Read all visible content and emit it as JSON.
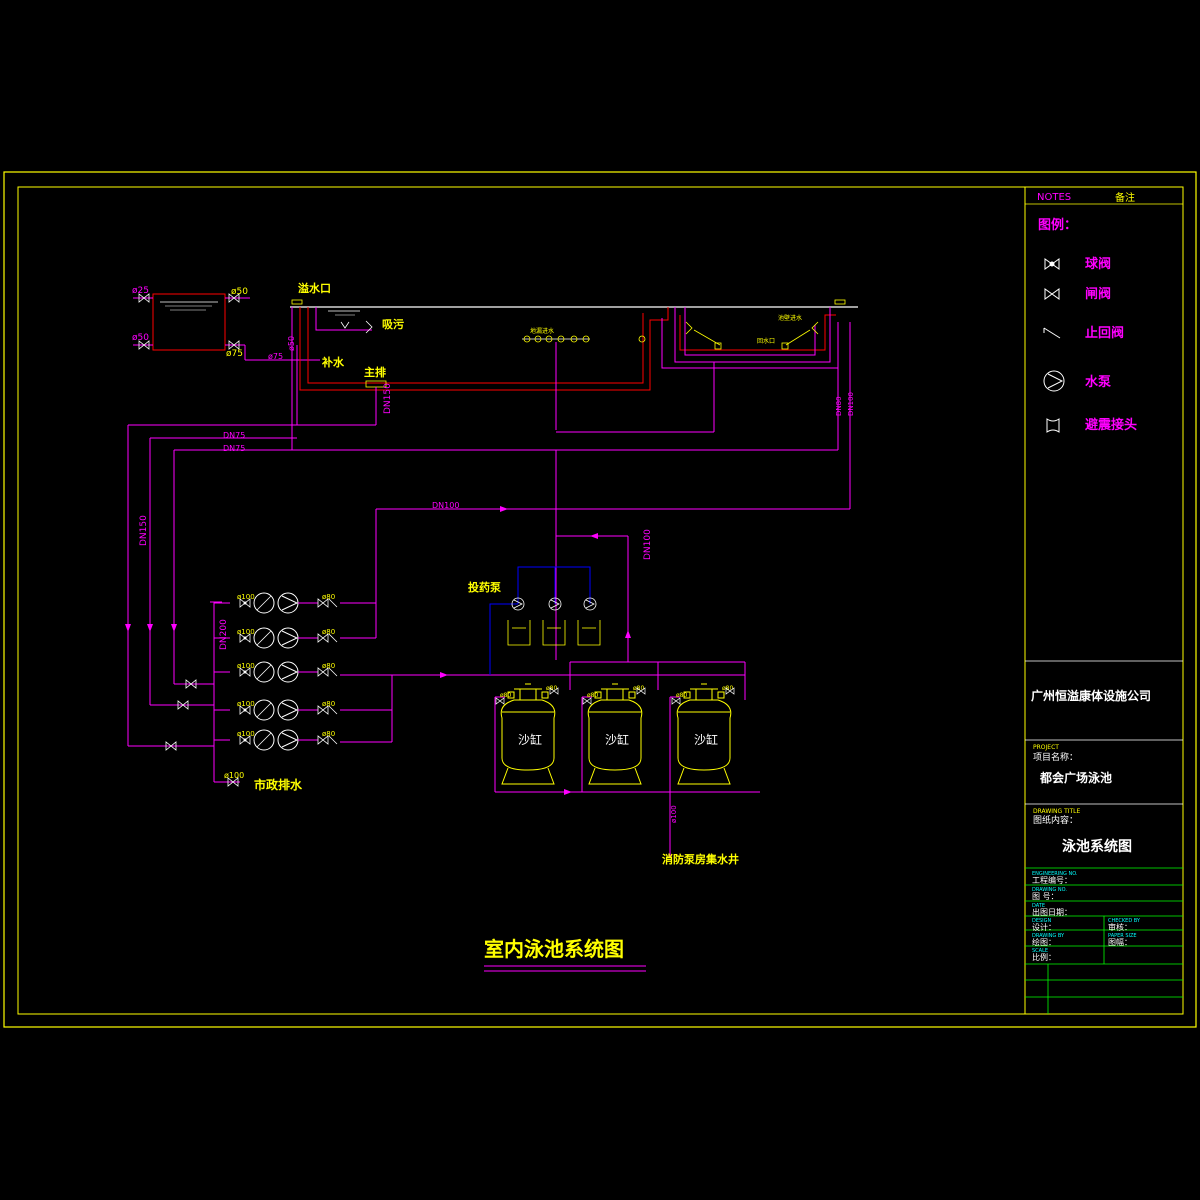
{
  "drawing": {
    "main_title": "室内泳池系统图"
  },
  "legend": {
    "notes_label": "NOTES",
    "notes_cn": "备注",
    "legend_title": "图例：",
    "items": [
      {
        "icon": "ball-valve-icon",
        "label": "球阀"
      },
      {
        "icon": "gate-valve-icon",
        "label": "闸阀"
      },
      {
        "icon": "check-valve-icon",
        "label": "止回阀"
      },
      {
        "icon": "pump-icon",
        "label": "水泵"
      },
      {
        "icon": "shock-absorber-joint-icon",
        "label": "避震接头"
      }
    ]
  },
  "title_block": {
    "company": "广州恒溢康体设施公司",
    "project_en": "PROJECT",
    "project_label": "项目名称：",
    "project_name": "都会广场泳池",
    "drawing_title_en": "DRAWING TITLE",
    "drawing_content_label": "图纸内容：",
    "drawing_name": "泳池系统图",
    "engineering_no_en": "ENGINEERING NO.",
    "engineering_no": "工程编号：",
    "drawing_no_en": "DRAWING NO.",
    "drawing_no": "图  号：",
    "date_en": "DATE",
    "date": "出图日期：",
    "design_en": "DESIGN",
    "design": "设计：",
    "checked_en": "CHECKED BY",
    "checked": "审核：",
    "drawn_en": "DRAWING BY",
    "drawn": "绘图：",
    "paper_en": "PAPER SIZE",
    "paper": "图幅：",
    "scale_en": "SCALE",
    "scale": "比例："
  },
  "labels": {
    "phi25": "ø25",
    "phi50_a": "ø50",
    "phi50_b": "ø50",
    "phi75_a": "ø75",
    "phi75_b": "ø75",
    "phi50_c": "ø50",
    "overflow": "溢水口",
    "suction": "吸污",
    "makeup": "补水",
    "main_drain": "主排",
    "dn150_v": "DN150",
    "dn75_a": "DN75",
    "dn75_b": "DN75",
    "dn150_left": "DN150",
    "dn100_h": "DN100",
    "dn100_v": "DN100",
    "dn80_v": "DN80",
    "dn100_v2": "DN100",
    "dn200": "DN200",
    "inlet_row": "地漏进水",
    "wall_inlet": "池壁进水",
    "return_inlet": "回水口",
    "dosing_pump": "投药泵",
    "municipal_drain": "市政排水",
    "fire_pit": "消防泵房集水井",
    "sand_tank": "沙缸",
    "phi100": "ø100",
    "phi80": "ø80",
    "phi100_v": "ø100"
  },
  "colors": {
    "pipe": "#ff00ff",
    "equipment": "#ffff00",
    "frame": "#ffff00",
    "grid": "#00ff00",
    "dosing": "#0000ff",
    "pool_line": "#ffffff",
    "drain": "#ff0000"
  }
}
